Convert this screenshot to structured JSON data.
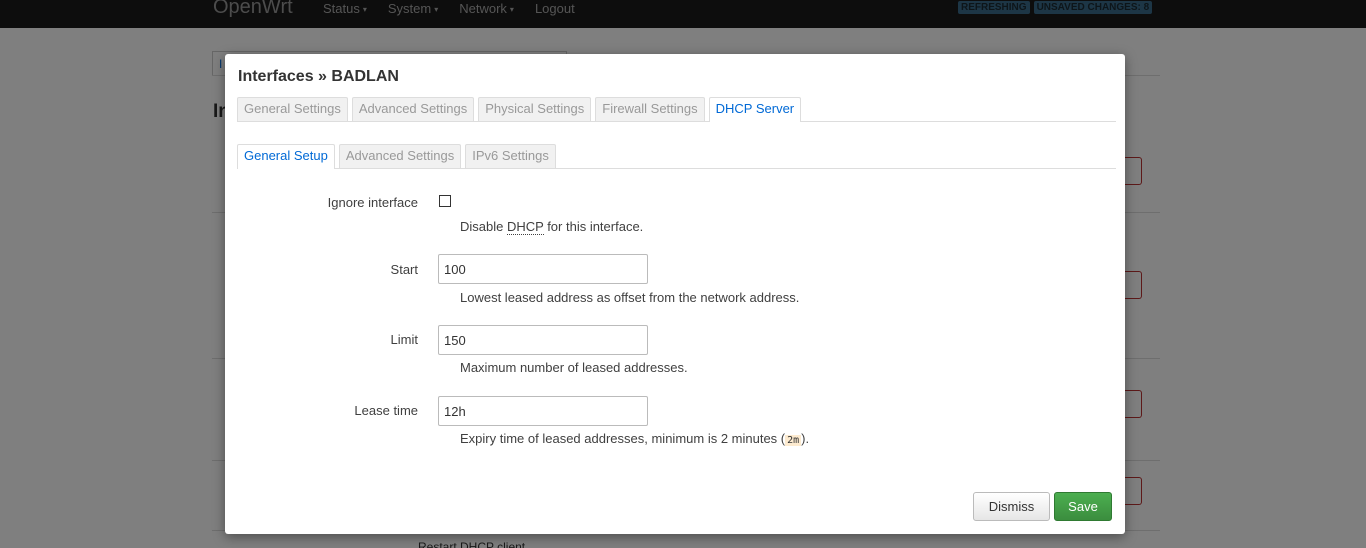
{
  "navbar": {
    "brand": "OpenWrt",
    "menu": [
      {
        "label": "Status",
        "caret": "▾"
      },
      {
        "label": "System",
        "caret": "▾"
      },
      {
        "label": "Network",
        "caret": "▾"
      },
      {
        "label": "Logout",
        "caret": ""
      }
    ],
    "badges": [
      "REFRESHING",
      "UNSAVED CHANGES: 8"
    ]
  },
  "background": {
    "tab_first": "I",
    "heading": "In",
    "footer_text": "Restart DHCP client"
  },
  "modal": {
    "title": "Interfaces » BADLAN",
    "tabs": [
      {
        "label": "General Settings",
        "active": false
      },
      {
        "label": "Advanced Settings",
        "active": false
      },
      {
        "label": "Physical Settings",
        "active": false
      },
      {
        "label": "Firewall Settings",
        "active": false
      },
      {
        "label": "DHCP Server",
        "active": true
      }
    ],
    "subtabs": [
      {
        "label": "General Setup",
        "active": true
      },
      {
        "label": "Advanced Settings",
        "active": false
      },
      {
        "label": "IPv6 Settings",
        "active": false
      }
    ],
    "ignore": {
      "label": "Ignore interface",
      "checked": false,
      "hint_pre": "Disable ",
      "hint_abbr": "DHCP",
      "hint_post": " for this interface."
    },
    "start": {
      "label": "Start",
      "value": "100",
      "hint": "Lowest leased address as offset from the network address."
    },
    "limit": {
      "label": "Limit",
      "value": "150",
      "hint": "Maximum number of leased addresses."
    },
    "leasetime": {
      "label": "Lease time",
      "value": "12h",
      "hint_pre": "Expiry time of leased addresses, minimum is 2 minutes (",
      "hint_code": "2m",
      "hint_post": ")."
    },
    "buttons": {
      "dismiss": "Dismiss",
      "save": "Save"
    }
  },
  "colors": {
    "accent": "#0069d6",
    "save_green": "#3b8d3e",
    "navbar": "#1b1b1b"
  }
}
